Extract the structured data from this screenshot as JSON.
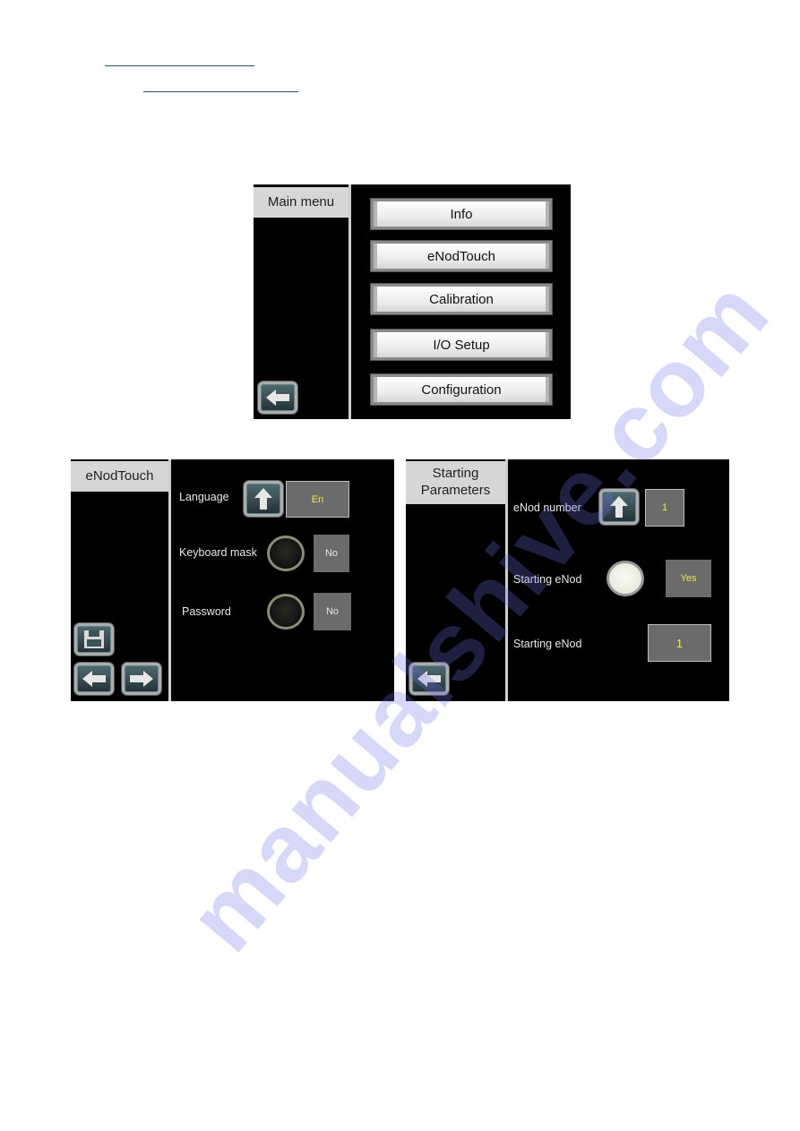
{
  "header_links": [
    {
      "label": ""
    },
    {
      "label": ""
    }
  ],
  "main_menu": {
    "title": "Main menu",
    "buttons": [
      "Info",
      "eNodTouch",
      "Calibration",
      "I/O Setup",
      "Configuration"
    ],
    "back_icon": "arrow-left-icon"
  },
  "enodtouch_screen": {
    "title": "eNodTouch",
    "rows": [
      {
        "label": "Language",
        "control": "up-arrow-button",
        "value": "En"
      },
      {
        "label": "Keyboard mask",
        "control": "toggle-off",
        "value": "No"
      },
      {
        "label": "Password",
        "control": "toggle-off",
        "value": "No"
      }
    ],
    "nav_icons": [
      "save-icon",
      "arrow-left-icon",
      "arrow-right-icon"
    ]
  },
  "starting_parameters_screen": {
    "title": "Starting Parameters",
    "title_line1": "Starting",
    "title_line2": "Parameters",
    "rows": [
      {
        "label": "eNod number",
        "control": "up-arrow-button",
        "value": "1"
      },
      {
        "label": "Starting eNod",
        "control": "toggle-on",
        "value": "Yes"
      },
      {
        "label": "Starting eNod",
        "control": "value-field",
        "value": "1"
      }
    ],
    "back_icon": "arrow-left-icon"
  },
  "watermark": "manualshive.com",
  "colors": {
    "screen_bg": "#000000",
    "sidebar_title_bg": "#d6d6d6",
    "value_box_bg": "#6b6b6b",
    "value_text": "#e9ef4a",
    "link_underline": "#2f4f63"
  }
}
